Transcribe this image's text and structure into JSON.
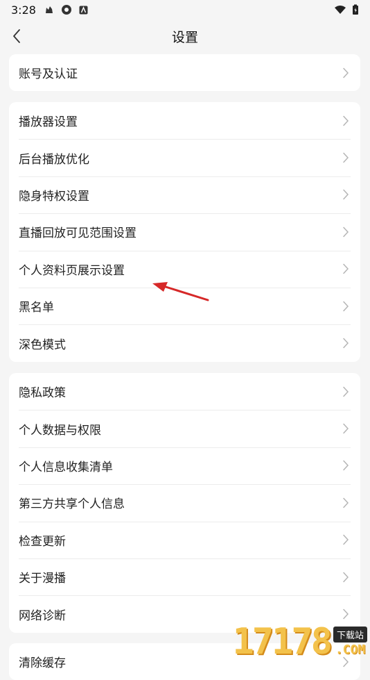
{
  "status_bar": {
    "time": "3:28"
  },
  "header": {
    "title": "设置"
  },
  "groups": [
    {
      "items": [
        {
          "label": "账号及认证"
        }
      ]
    },
    {
      "items": [
        {
          "label": "播放器设置"
        },
        {
          "label": "后台播放优化"
        },
        {
          "label": "隐身特权设置"
        },
        {
          "label": "直播回放可见范围设置"
        },
        {
          "label": "个人资料页展示设置"
        },
        {
          "label": "黑名单"
        },
        {
          "label": "深色模式"
        }
      ]
    },
    {
      "items": [
        {
          "label": "隐私政策"
        },
        {
          "label": "个人数据与权限"
        },
        {
          "label": "个人信息收集清单"
        },
        {
          "label": "第三方共享个人信息"
        },
        {
          "label": "检查更新"
        },
        {
          "label": "关于漫播"
        },
        {
          "label": "网络诊断"
        }
      ]
    },
    {
      "items": [
        {
          "label": "清除缓存"
        }
      ]
    }
  ],
  "watermark": {
    "number": "17178",
    "badge": "下载站",
    "suffix": ".COM"
  },
  "colors": {
    "background": "#f5f5f5",
    "card": "#ffffff",
    "arrow": "#d62828",
    "watermark": "#f3c24b"
  }
}
